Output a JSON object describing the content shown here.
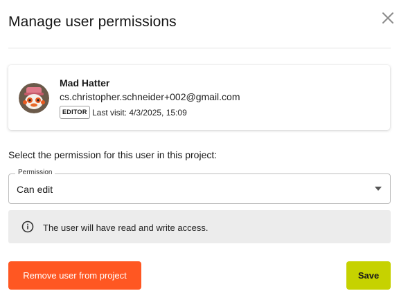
{
  "dialog": {
    "title": "Manage user permissions",
    "close_icon": "close-icon"
  },
  "user": {
    "name": "Mad Hatter",
    "email": "cs.christopher.schneider+002@gmail.com",
    "role": "EDITOR",
    "last_visit": "Last visit: 4/3/2025, 15:09",
    "avatar_icon": "avatar"
  },
  "permission": {
    "prompt": "Select the permission for this user in this project:",
    "label": "Permission",
    "value": "Can edit",
    "info_icon": "info-icon",
    "info_text": "The user will have read and write access."
  },
  "actions": {
    "remove_label": "Remove user from project",
    "save_label": "Save"
  },
  "colors": {
    "remove_button": "#ff5722",
    "save_button": "#c6d200",
    "info_background": "#ececec"
  }
}
